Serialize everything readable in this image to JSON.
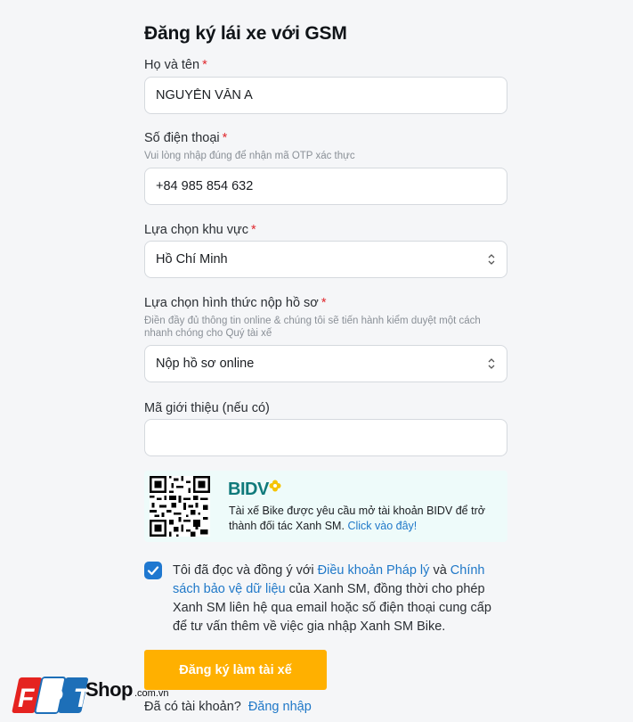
{
  "form": {
    "title": "Đăng ký lái xe với GSM",
    "required_mark": "*",
    "name": {
      "label": "Họ và tên",
      "value": "NGUYỄN VĂN A"
    },
    "phone": {
      "label": "Số điện thoại",
      "hint": "Vui lòng nhập đúng để nhận mã OTP xác thực",
      "value": "+84 985 854 632"
    },
    "region": {
      "label": "Lựa chọn khu vực",
      "value": "Hồ Chí Minh"
    },
    "submission": {
      "label": "Lựa chọn hình thức nộp hồ sơ",
      "hint": "Điền đầy đủ thông tin online & chúng tôi sẽ tiến hành kiểm duyệt một cách nhanh chóng cho Quý tài xế",
      "value": "Nộp hồ sơ online"
    },
    "referral": {
      "label": "Mã giới thiệu (nếu có)",
      "value": ""
    },
    "bidv_banner": {
      "logo": "BIDV",
      "text": "Tài xế Bike được yêu cầu mở tài khoản BIDV để trở thành đối tác Xanh SM.",
      "link": "Click vào đây!"
    },
    "consent": {
      "checked": true,
      "text_1": "Tôi đã đọc và đồng ý với",
      "link_terms": "Điều khoản Pháp lý",
      "text_2": "và",
      "link_privacy": "Chính sách bảo vệ dữ liệu",
      "text_3": "của Xanh SM, đồng thời cho phép Xanh SM liên hệ qua email hoặc số điện thoại cung cấp để tư vấn thêm về việc gia nhập Xanh SM Bike."
    },
    "submit_label": "Đăng ký làm tài xế",
    "login_prompt": "Đã có tài khoản?",
    "login_link": "Đăng nhập"
  },
  "watermark": {
    "brand": "FPT",
    "shop": "Shop",
    "domain": ".com.vn"
  },
  "colors": {
    "accent": "#1f78c8",
    "submit": "#ffb000",
    "required": "#e0282e",
    "bidv": "#107a7b"
  }
}
